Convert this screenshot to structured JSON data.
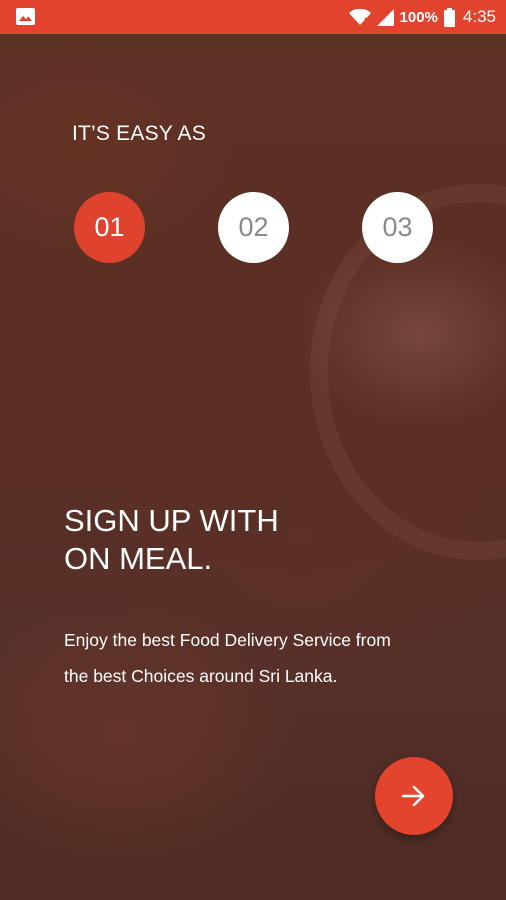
{
  "status_bar": {
    "battery_percent": "100%",
    "time": "4:35",
    "icons": [
      "gallery-icon",
      "wifi-icon",
      "signal-icon",
      "battery-icon"
    ]
  },
  "onboarding": {
    "heading": "IT’S EASY AS",
    "steps": [
      {
        "label": "01",
        "active": true
      },
      {
        "label": "02",
        "active": false
      },
      {
        "label": "03",
        "active": false
      }
    ],
    "title_line1": "SIGN UP WITH",
    "title_line2": "ON MEAL.",
    "description_line1": "Enjoy the best Food Delivery Service from",
    "description_line2": "the best Choices around Sri Lanka.",
    "next_icon": "arrow-right-icon"
  },
  "colors": {
    "accent": "#e2432e",
    "inactive_step_text": "#8a8a8a",
    "background": "#5a2e22"
  }
}
